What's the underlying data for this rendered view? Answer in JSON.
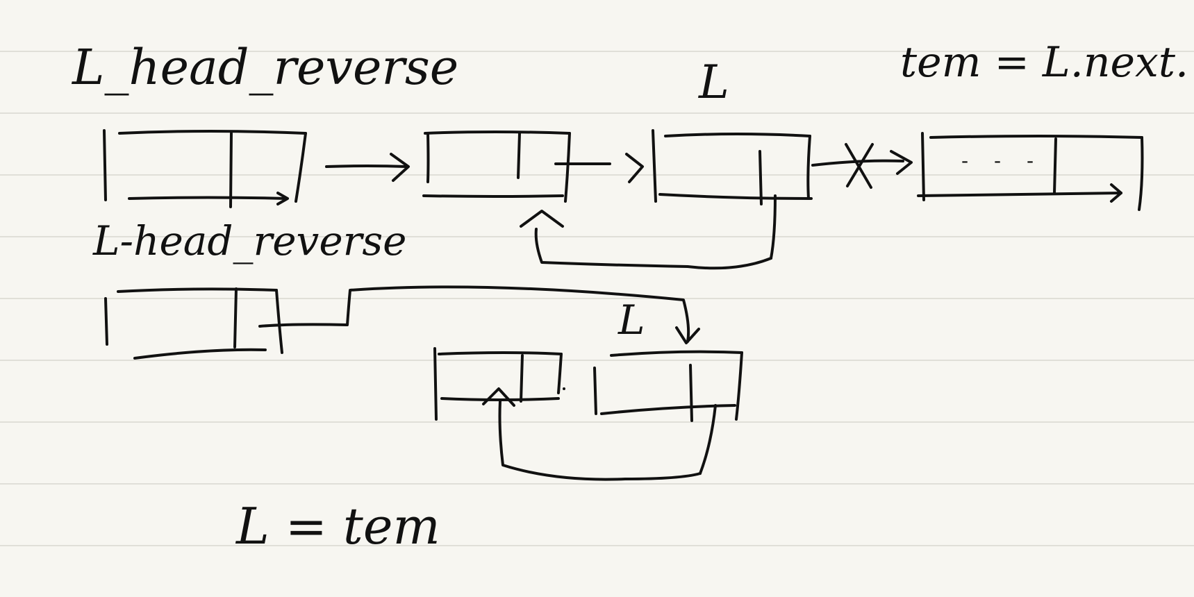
{
  "labels": {
    "top_head": "L_head_reverse",
    "pointer_l_top": "L",
    "tem_assign": "tem = L.next.",
    "second_head": "L-head_reverse",
    "pointer_l_bottom": "L",
    "final_assign": "L = tem",
    "ellipsis": "- - -"
  },
  "colors": {
    "paper": "#f7f6f1",
    "ink": "#111111",
    "rule": "#d9d7cf"
  }
}
